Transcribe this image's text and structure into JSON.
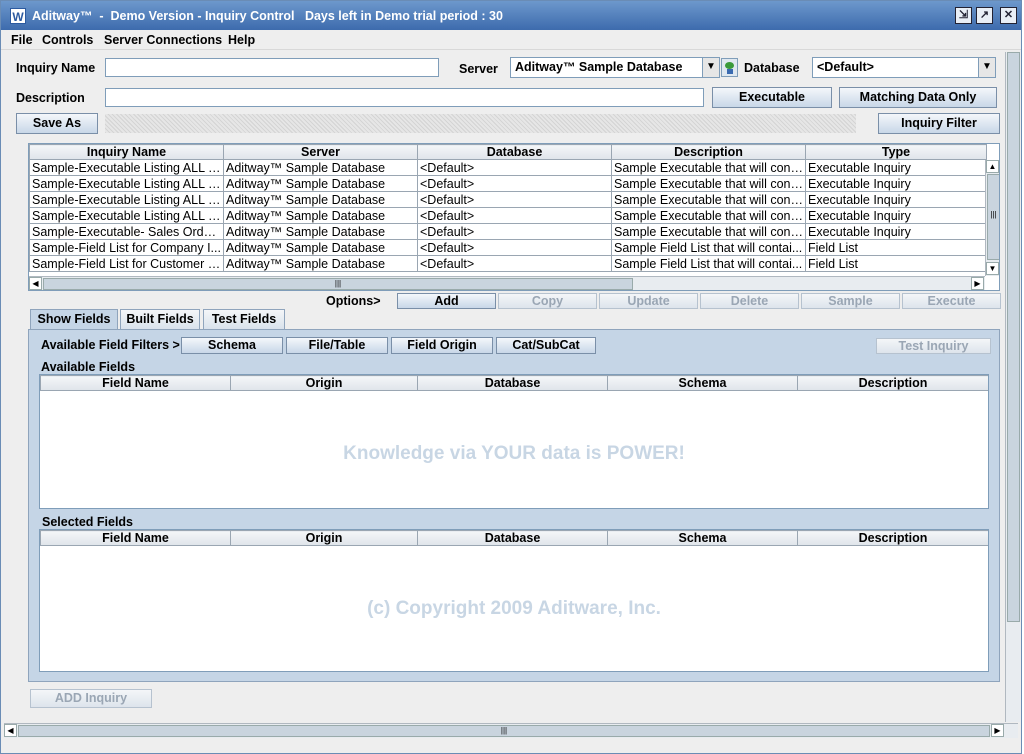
{
  "window": {
    "app_icon_letter": "W",
    "title": "Aditway™  -  Demo Version - Inquiry Control   Days left in Demo trial period : 30"
  },
  "menu": [
    "File",
    "Controls",
    "Server Connections",
    "Help"
  ],
  "form": {
    "inquiry_name_label": "Inquiry Name",
    "inquiry_name_value": "",
    "server_label": "Server",
    "server_value": "Aditway™ Sample Database",
    "database_label": "Database",
    "database_value": "<Default>",
    "description_label": "Description",
    "description_value": "",
    "executable_button": "Executable",
    "matching_button": "Matching Data Only",
    "save_as_button": "Save As",
    "inquiry_filter_button": "Inquiry Filter"
  },
  "inquiry_table": {
    "columns": [
      "Inquiry Name",
      "Server",
      "Database",
      "Description",
      "Type"
    ],
    "rows": [
      [
        "Sample-Executable Listing ALL S...",
        "Aditway™ Sample Database",
        "<Default>",
        "Sample Executable that will cont...",
        "Executable Inquiry"
      ],
      [
        "Sample-Executable Listing ALL S...",
        "Aditway™ Sample Database",
        "<Default>",
        "Sample Executable that will cont...",
        "Executable Inquiry"
      ],
      [
        "Sample-Executable Listing ALL S...",
        "Aditway™ Sample Database",
        "<Default>",
        "Sample Executable that will cont...",
        "Executable Inquiry"
      ],
      [
        "Sample-Executable Listing ALL S...",
        "Aditway™ Sample Database",
        "<Default>",
        "Sample Executable that will cont...",
        "Executable Inquiry"
      ],
      [
        "Sample-Executable- Sales Order...",
        "Aditway™ Sample Database",
        "<Default>",
        "Sample Executable that will cont...",
        "Executable Inquiry"
      ],
      [
        "Sample-Field List for Company I...",
        "Aditway™ Sample Database",
        "<Default>",
        "Sample Field List that will contai...",
        "Field List"
      ],
      [
        "Sample-Field List for Customer I...",
        "Aditway™ Sample Database",
        "<Default>",
        "Sample Field List that will contai...",
        "Field List"
      ]
    ]
  },
  "options": {
    "label": "Options>",
    "buttons": [
      "Add",
      "Copy",
      "Update",
      "Delete",
      "Sample",
      "Execute"
    ]
  },
  "tabs": [
    "Show Fields",
    "Built Fields",
    "Test Fields"
  ],
  "filters": {
    "label": "Available Field Filters >",
    "buttons": [
      "Schema",
      "File/Table",
      "Field Origin",
      "Cat/SubCat"
    ],
    "test_inquiry": "Test Inquiry"
  },
  "available_fields": {
    "title": "Available Fields",
    "columns": [
      "Field Name",
      "Origin",
      "Database",
      "Schema",
      "Description"
    ],
    "watermark": "Knowledge via YOUR data is POWER!"
  },
  "selected_fields": {
    "title": "Selected Fields",
    "columns": [
      "Field Name",
      "Origin",
      "Database",
      "Schema",
      "Description"
    ],
    "watermark": "(c) Copyright 2009  Aditware, Inc."
  },
  "add_inquiry_button": "ADD Inquiry",
  "scroll_grip": "|||"
}
